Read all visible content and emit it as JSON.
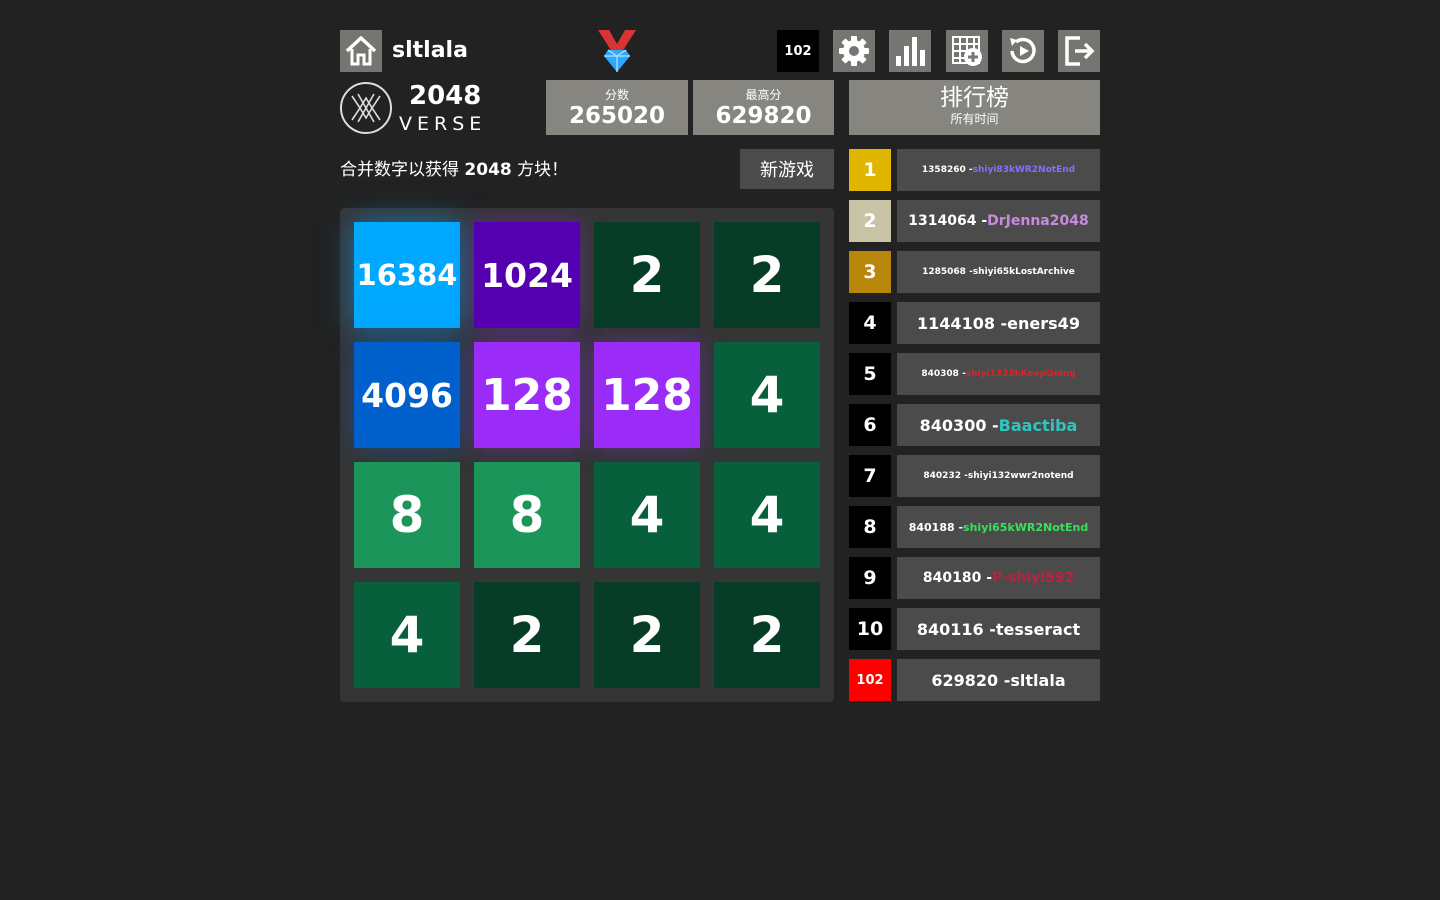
{
  "header": {
    "username": "sltlala",
    "rank": "102",
    "icons": [
      "home-icon",
      "medal-icon",
      "gear-icon",
      "bar-chart-icon",
      "add-grid-icon",
      "replay-icon",
      "logout-icon"
    ]
  },
  "logo": {
    "title": "2048",
    "subtitle": "VERSE"
  },
  "score": {
    "label": "分数",
    "value": "265020"
  },
  "best": {
    "label": "最高分",
    "value": "629820"
  },
  "leaderboard_header": {
    "title": "排行榜",
    "subtitle": "所有时间"
  },
  "tagline": {
    "prefix": "合并数字以获得 ",
    "bold": "2048",
    "suffix": " 方块！"
  },
  "new_game_label": "新游戏",
  "tiles": [
    {
      "value": "16384",
      "color": "#00a8ff"
    },
    {
      "value": "1024",
      "color": "#5500b0"
    },
    {
      "value": "2",
      "color": "#073c27"
    },
    {
      "value": "2",
      "color": "#073c27"
    },
    {
      "value": "4096",
      "color": "#0060cc"
    },
    {
      "value": "128",
      "color": "#9b2cf8"
    },
    {
      "value": "128",
      "color": "#9b2cf8"
    },
    {
      "value": "4",
      "color": "#07603b"
    },
    {
      "value": "8",
      "color": "#1b9559"
    },
    {
      "value": "8",
      "color": "#1b9559"
    },
    {
      "value": "4",
      "color": "#07603b"
    },
    {
      "value": "4",
      "color": "#07603b"
    },
    {
      "value": "4",
      "color": "#07603b"
    },
    {
      "value": "2",
      "color": "#073c27"
    },
    {
      "value": "2",
      "color": "#073c27"
    },
    {
      "value": "2",
      "color": "#073c27"
    }
  ],
  "leaderboard": [
    {
      "rank": "1",
      "rank_bg": "#e0b500",
      "score": "1358260",
      "name": "shiyi83kWR2NotEnd",
      "name_color": "#8a6cff"
    },
    {
      "rank": "2",
      "rank_bg": "#c9c3a5",
      "score": "1314064",
      "name": "DrJenna2048",
      "name_color": "#c88ae0"
    },
    {
      "rank": "3",
      "rank_bg": "#b8860b",
      "score": "1285068",
      "name": "shiyi65kLostArchive",
      "name_color": "#ffffff"
    },
    {
      "rank": "4",
      "rank_bg": "#000000",
      "score": "1144108",
      "name": "eners49",
      "name_color": "#ffffff"
    },
    {
      "rank": "5",
      "rank_bg": "#000000",
      "score": "840308",
      "name": "shiyi1323kKeepGoing",
      "name_color": "#e0202a"
    },
    {
      "rank": "6",
      "rank_bg": "#000000",
      "score": "840300",
      "name": "Baactiba",
      "name_color": "#2ec6c0"
    },
    {
      "rank": "7",
      "rank_bg": "#000000",
      "score": "840232",
      "name": "shiyi132wwr2notend",
      "name_color": "#ffffff"
    },
    {
      "rank": "8",
      "rank_bg": "#000000",
      "score": "840188",
      "name": "shiyi65kWR2NotEnd",
      "name_color": "#39e05a"
    },
    {
      "rank": "9",
      "rank_bg": "#000000",
      "score": "840180",
      "name": "P-shiyi592",
      "name_color": "#c02040"
    },
    {
      "rank": "10",
      "rank_bg": "#000000",
      "score": "840116",
      "name": "tesseract",
      "name_color": "#ffffff"
    },
    {
      "rank": "102",
      "rank_bg": "#ff0000",
      "score": "629820",
      "name": "sltlala",
      "name_color": "#ffffff"
    }
  ]
}
